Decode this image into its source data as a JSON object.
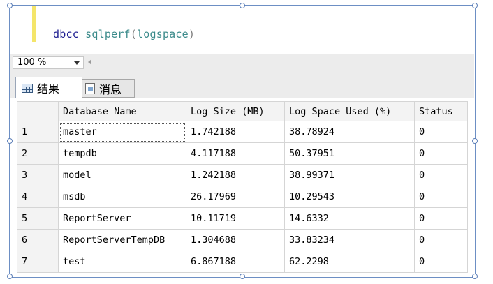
{
  "editor": {
    "keyword": "dbcc",
    "function": "sqlperf",
    "open_paren": "(",
    "argument": "logspace",
    "close_paren": ")"
  },
  "zoom": {
    "value": "100 %"
  },
  "tabs": [
    {
      "label": "结果",
      "icon": "grid-icon"
    },
    {
      "label": "消息",
      "icon": "message-doc-icon"
    }
  ],
  "results": {
    "columns": [
      "",
      "Database Name",
      "Log Size (MB)",
      "Log Space Used (%)",
      "Status"
    ],
    "rows": [
      [
        "1",
        "master",
        "1.742188",
        "38.78924",
        "0"
      ],
      [
        "2",
        "tempdb",
        "4.117188",
        "50.37951",
        "0"
      ],
      [
        "3",
        "model",
        "1.242188",
        "38.99371",
        "0"
      ],
      [
        "4",
        "msdb",
        "26.17969",
        "10.29543",
        "0"
      ],
      [
        "5",
        "ReportServer",
        "10.11719",
        "14.6332",
        "0"
      ],
      [
        "6",
        "ReportServerTempDB",
        "1.304688",
        "33.83234",
        "0"
      ],
      [
        "7",
        "test",
        "6.867188",
        "62.2298",
        "0"
      ]
    ]
  }
}
